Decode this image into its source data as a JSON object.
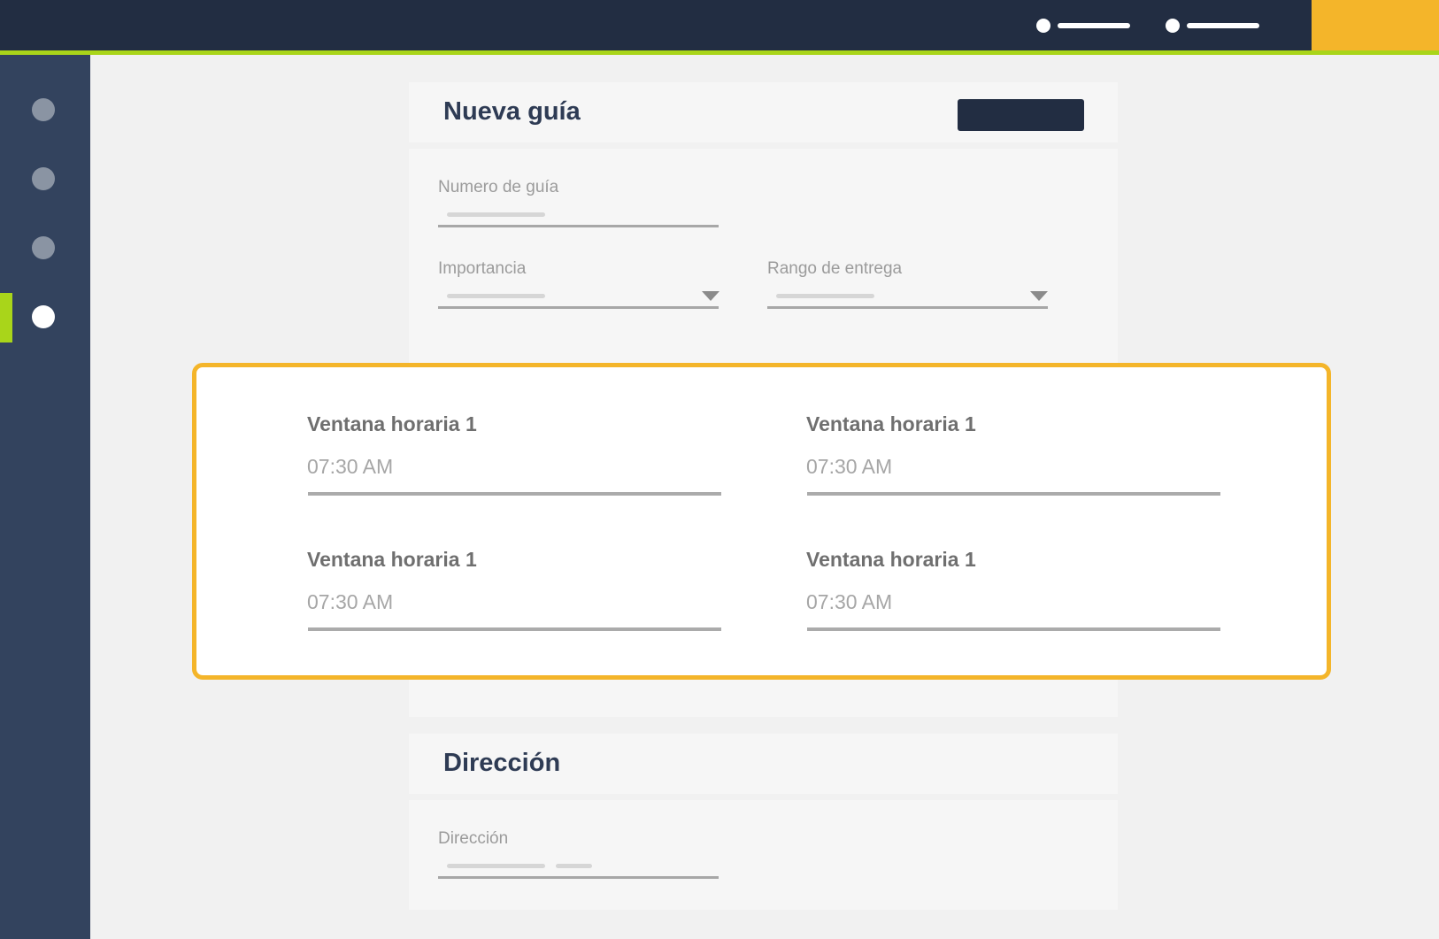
{
  "colors": {
    "topbar": "#222d42",
    "accent_green": "#a9d51a",
    "accent_orange": "#f4b52a",
    "sidebar": "#33435e",
    "primary_button": "#222d42",
    "highlight_border": "#f4b52a"
  },
  "topbar": {
    "nav_items": [
      {
        "icon": "dot-icon"
      },
      {
        "icon": "dot-icon"
      }
    ]
  },
  "sidebar": {
    "items": [
      {
        "state": "inactive"
      },
      {
        "state": "inactive"
      },
      {
        "state": "inactive"
      },
      {
        "state": "active"
      }
    ]
  },
  "guide_card": {
    "title": "Nueva guía",
    "fields": {
      "guide_number": {
        "label": "Numero de guía"
      },
      "importance": {
        "label": "Importancia",
        "icon": "caret-down-icon"
      },
      "delivery_range": {
        "label": "Rango de entrega",
        "icon": "caret-down-icon"
      }
    }
  },
  "time_windows": [
    {
      "label": "Ventana horaria 1",
      "value": "07:30 AM"
    },
    {
      "label": "Ventana horaria 1",
      "value": "07:30 AM"
    },
    {
      "label": "Ventana horaria 1",
      "value": "07:30 AM"
    },
    {
      "label": "Ventana horaria 1",
      "value": "07:30 AM"
    }
  ],
  "address_card": {
    "title": "Dirección",
    "fields": {
      "address": {
        "label": "Dirección"
      }
    }
  }
}
